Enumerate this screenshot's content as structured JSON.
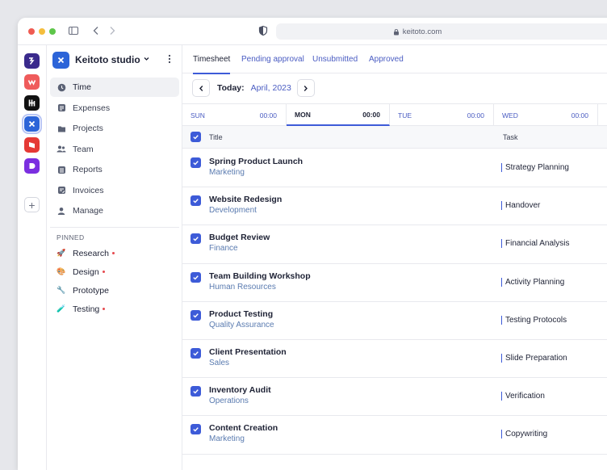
{
  "browser": {
    "url": "keitoto.com"
  },
  "rail_apps": [
    {
      "name": "app-1",
      "color": "#3a2a8c",
      "glyph": "⁝"
    },
    {
      "name": "app-2",
      "color": "#ef5b5b",
      "glyph": "w"
    },
    {
      "name": "app-3",
      "color": "#111111",
      "glyph": "H"
    },
    {
      "name": "app-4",
      "color": "#2c64d8",
      "glyph": "✕"
    },
    {
      "name": "app-5",
      "color": "#e53935",
      "glyph": "▶"
    },
    {
      "name": "app-6",
      "color": "#7b2fe0",
      "glyph": "◗"
    }
  ],
  "sidebar": {
    "workspace": "Keitoto studio",
    "items": [
      {
        "label": "Time",
        "icon": "clock-icon"
      },
      {
        "label": "Expenses",
        "icon": "receipt-icon"
      },
      {
        "label": "Projects",
        "icon": "folder-icon"
      },
      {
        "label": "Team",
        "icon": "people-icon"
      },
      {
        "label": "Reports",
        "icon": "report-icon"
      },
      {
        "label": "Invoices",
        "icon": "invoice-icon"
      },
      {
        "label": "Manage",
        "icon": "user-gear-icon"
      }
    ],
    "pinned_title": "PINNED",
    "pinned": [
      {
        "label": "Research",
        "emoji": "🚀"
      },
      {
        "label": "Design",
        "emoji": "🎨"
      },
      {
        "label": "Prototype",
        "emoji": "🔧"
      },
      {
        "label": "Testing",
        "emoji": "🧪"
      }
    ]
  },
  "tabs": [
    "Timesheet",
    "Pending approval",
    "Unsubmitted",
    "Approved"
  ],
  "date": {
    "today_label": "Today:",
    "month": "April, 2023"
  },
  "days": [
    {
      "label": "SUN",
      "time": "00:00"
    },
    {
      "label": "MON",
      "time": "00:00"
    },
    {
      "label": "TUE",
      "time": "00:00"
    },
    {
      "label": "WED",
      "time": "00:00"
    }
  ],
  "table": {
    "columns": {
      "title": "Title",
      "task": "Task"
    },
    "rows": [
      {
        "title": "Spring Product Launch",
        "category": "Marketing",
        "task": "Strategy Planning"
      },
      {
        "title": "Website Redesign",
        "category": "Development",
        "task": "Handover"
      },
      {
        "title": "Budget Review",
        "category": "Finance",
        "task": "Financial Analysis"
      },
      {
        "title": "Team Building Workshop",
        "category": "Human Resources",
        "task": "Activity Planning"
      },
      {
        "title": "Product Testing",
        "category": "Quality Assurance",
        "task": "Testing Protocols"
      },
      {
        "title": "Client Presentation",
        "category": "Sales",
        "task": "Slide Preparation"
      },
      {
        "title": "Inventory Audit",
        "category": "Operations",
        "task": "Verification"
      },
      {
        "title": "Content Creation",
        "category": "Marketing",
        "task": "Copywriting"
      }
    ]
  },
  "colors": {
    "accent": "#3d5bd8",
    "link": "#4a5cc2",
    "muted": "#5a7bb0"
  }
}
